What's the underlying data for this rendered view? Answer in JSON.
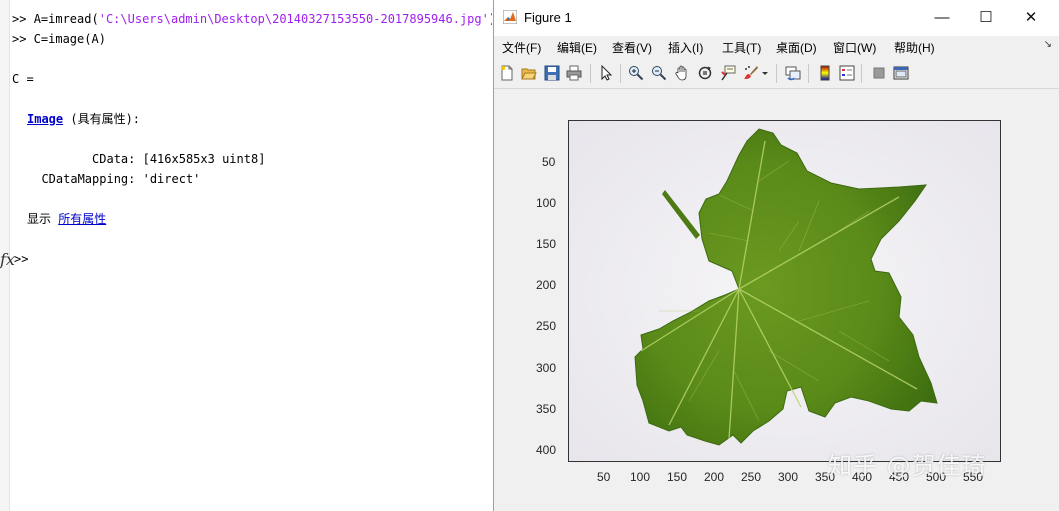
{
  "command_window": {
    "lines": {
      "l1_prompt": ">> ",
      "l1_cmd": "A=imread(",
      "l1_str": "'C:\\Users\\admin\\Desktop\\20140327153550-2017895946.jpg'",
      "l1_end": ");",
      "l2": ">> C=image(A)",
      "l3": "C =",
      "l4_link": "Image",
      "l4_rest": " (具有属性):",
      "l5": "         CData: [416x585x3 uint8]",
      "l6": "  CDataMapping: 'direct'",
      "l7_pre": "显示 ",
      "l7_link": "所有属性",
      "prompt": ">>",
      "fx": "fx"
    }
  },
  "figure": {
    "title": "Figure 1",
    "window_buttons": {
      "minimize": "—",
      "maximize": "☐",
      "close": "✕"
    },
    "menu": {
      "file": "文件(F)",
      "edit": "编辑(E)",
      "view": "查看(V)",
      "insert": "插入(I)",
      "tools": "工具(T)",
      "desktop": "桌面(D)",
      "window": "窗口(W)",
      "help": "帮助(H)",
      "more": "↘"
    },
    "toolbar_icons": [
      "new-figure-icon",
      "open-icon",
      "save-icon",
      "print-icon",
      "pointer-icon",
      "zoom-in-icon",
      "zoom-out-icon",
      "pan-icon",
      "rotate-icon",
      "data-cursor-icon",
      "brush-icon",
      "brush-dropdown-icon",
      "link-plot-icon",
      "colorbar-icon",
      "legend-icon",
      "hide-plot-tools-icon",
      "show-plot-tools-icon"
    ],
    "axes": {
      "yticks": [
        "50",
        "100",
        "150",
        "200",
        "250",
        "300",
        "350",
        "400"
      ],
      "xticks": [
        "50",
        "100",
        "150",
        "200",
        "250",
        "300",
        "350",
        "400",
        "450",
        "500",
        "550"
      ]
    },
    "watermark": "知乎 @贺佳琦"
  }
}
